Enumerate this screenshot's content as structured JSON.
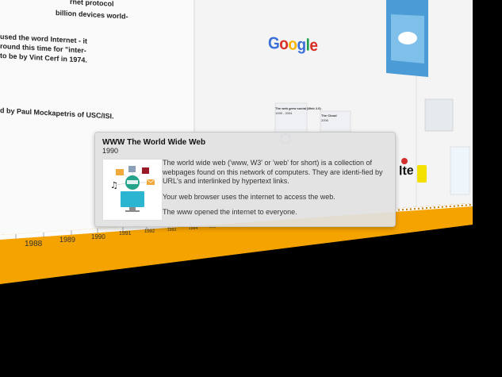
{
  "left_text": {
    "line_protocol": "rnet protocol",
    "line_devices": "billion devices world-",
    "line_used": "used the word Internet - it",
    "line_around": "round this time for \"inter-",
    "line_cerf": "to be by Vint Cerf in 1974.",
    "line_dns": "d by Paul Mockapetris of USC/ISI."
  },
  "timeline": {
    "years": [
      "1988",
      "1989",
      "1990",
      "1991",
      "1992",
      "1993",
      "1994",
      "1995"
    ]
  },
  "google_logo": {
    "letters": [
      "G",
      "o",
      "o",
      "g",
      "l",
      "e"
    ],
    "colors": [
      "#3b6fd8",
      "#d93025",
      "#f4b400",
      "#3b6fd8",
      "#1e9d4a",
      "#d93025"
    ]
  },
  "cards_bg": {
    "www_mini_title": "The web grew social (Web 2.0)",
    "www_mini_year": "1999 - 2004",
    "cloud_mini_title": "The Cloud",
    "cloud_mini_year": "2006",
    "lte_label": "lte"
  },
  "popup": {
    "title": "WWW The World Wide Web",
    "year": "1990",
    "paragraph1": "The world wide web ('www, W3' or 'web' for short) is a collection of webpages found on this network of computers. They are identi-fied by URL's and interlinked by hypertext links.",
    "paragraph2": "Your web browser uses the internet to access the web.",
    "paragraph3": "The www opened the internet to everyone."
  },
  "colors": {
    "timeline_orange": "#f5a300",
    "background": "#000000",
    "popup_bg": "#e1e1e1"
  }
}
